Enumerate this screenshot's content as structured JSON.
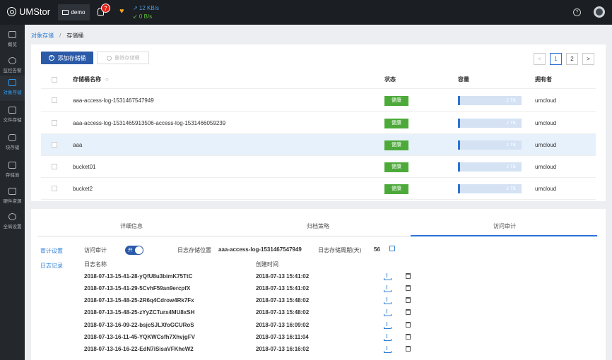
{
  "topbar": {
    "logo": "UMStor",
    "project": "demo",
    "alert_count": "7",
    "net_up": "↗ 12 KB/s",
    "net_down": "↙ 0 B/s",
    "help": "?"
  },
  "sidebar": {
    "items": [
      {
        "label": "概览",
        "icon": "home-icon"
      },
      {
        "label": "监控告警",
        "icon": "eye-icon"
      },
      {
        "label": "对象存储",
        "icon": "object-storage-icon"
      },
      {
        "label": "文件存储",
        "icon": "folder-icon"
      },
      {
        "label": "块存储",
        "icon": "database-icon"
      },
      {
        "label": "存储池",
        "icon": "chart-icon"
      },
      {
        "label": "硬件资源",
        "icon": "hardware-icon"
      },
      {
        "label": "全局设置",
        "icon": "gear-icon"
      }
    ],
    "active_index": 2
  },
  "breadcrumb": {
    "root": "对象存储",
    "sep": "/",
    "current": "存储桶"
  },
  "toolbar": {
    "add_label": "添加存储桶",
    "delete_label": "删除存储桶"
  },
  "pagination": {
    "prev": "<",
    "pages": [
      "1",
      "2"
    ],
    "next": ">",
    "current": "1"
  },
  "table": {
    "headers": {
      "name": "存储桶名称",
      "status": "状态",
      "capacity": "容量",
      "owner": "拥有者"
    },
    "rows": [
      {
        "name": "aaa-access-log-1531467547949",
        "status": "健康",
        "capacity": "2 TB",
        "owner": "umcloud",
        "highlight": false
      },
      {
        "name": "aaa-access-log-1531465913506-access-log-1531466059239",
        "status": "健康",
        "capacity": "2 TB",
        "owner": "umcloud",
        "highlight": false
      },
      {
        "name": "aaa",
        "status": "健康",
        "capacity": "2 TB",
        "owner": "umcloud",
        "highlight": true
      },
      {
        "name": "bucket01",
        "status": "健康",
        "capacity": "2 TB",
        "owner": "umcloud",
        "highlight": false
      },
      {
        "name": "bucket2",
        "status": "健康",
        "capacity": "2 TB",
        "owner": "umcloud",
        "highlight": false
      }
    ]
  },
  "detail": {
    "tabs": [
      "详细信息",
      "归档策略",
      "访问审计"
    ],
    "active_tab": 2,
    "nav": {
      "audit_settings": "审计设置",
      "log_records": "日志记录"
    },
    "audit": {
      "access_audit_label": "访问审计",
      "toggle_text": "开",
      "log_location_label": "日志存储位置",
      "log_location_value": "aaa-access-log-1531467547949",
      "log_period_label": "日志存储周期(天)",
      "log_period_value": "56"
    },
    "logs": {
      "headers": {
        "name": "日志名称",
        "time": "创建时间"
      },
      "rows": [
        {
          "name": "2018-07-13-15-41-28-yQfU8u3bimK75TtC",
          "time": "2018-07-13 15:41:02"
        },
        {
          "name": "2018-07-13-15-41-29-5CvhF59an9ercpfX",
          "time": "2018-07-13 15:41:02"
        },
        {
          "name": "2018-07-13-15-48-25-2R6q4Cdrow4Rk7Fx",
          "time": "2018-07-13 15:48:02"
        },
        {
          "name": "2018-07-13-15-48-25-zYyZCTurx4MU8xSH",
          "time": "2018-07-13 15:48:02"
        },
        {
          "name": "2018-07-13-16-09-22-bsjcSJLXfoGCURoS",
          "time": "2018-07-13 16:09:02"
        },
        {
          "name": "2018-07-13-16-11-45-YQKWCsfh7XhvjgFV",
          "time": "2018-07-13 16:11:04"
        },
        {
          "name": "2018-07-13-16-16-22-EdN7iSisaVFKheW2",
          "time": "2018-07-13 16:16:02"
        }
      ]
    }
  },
  "colors": {
    "primary": "#2a5aa8",
    "health": "#4daa3a",
    "link": "#2f7fd6",
    "topbar": "#1b1e22",
    "sidebar": "#24282d"
  }
}
